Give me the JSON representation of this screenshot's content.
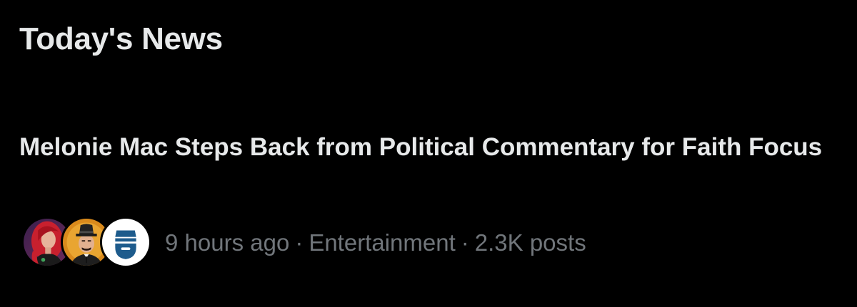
{
  "section": {
    "title": "Today's News"
  },
  "story": {
    "headline": "Melonie Mac Steps Back from Political Commentary for Faith Focus",
    "time_ago": "9 hours ago",
    "separator": "·",
    "category": "Entertainment",
    "post_count": "2.3K posts",
    "avatars": [
      {
        "icon": "woman-red-hair-avatar"
      },
      {
        "icon": "man-fedora-avatar"
      },
      {
        "icon": "bearded-man-logo-avatar"
      }
    ]
  },
  "colors": {
    "background": "#000000",
    "primary_text": "#e7e9ea",
    "secondary_text": "#71767b",
    "avatar_3_accent": "#1d5b8c"
  }
}
